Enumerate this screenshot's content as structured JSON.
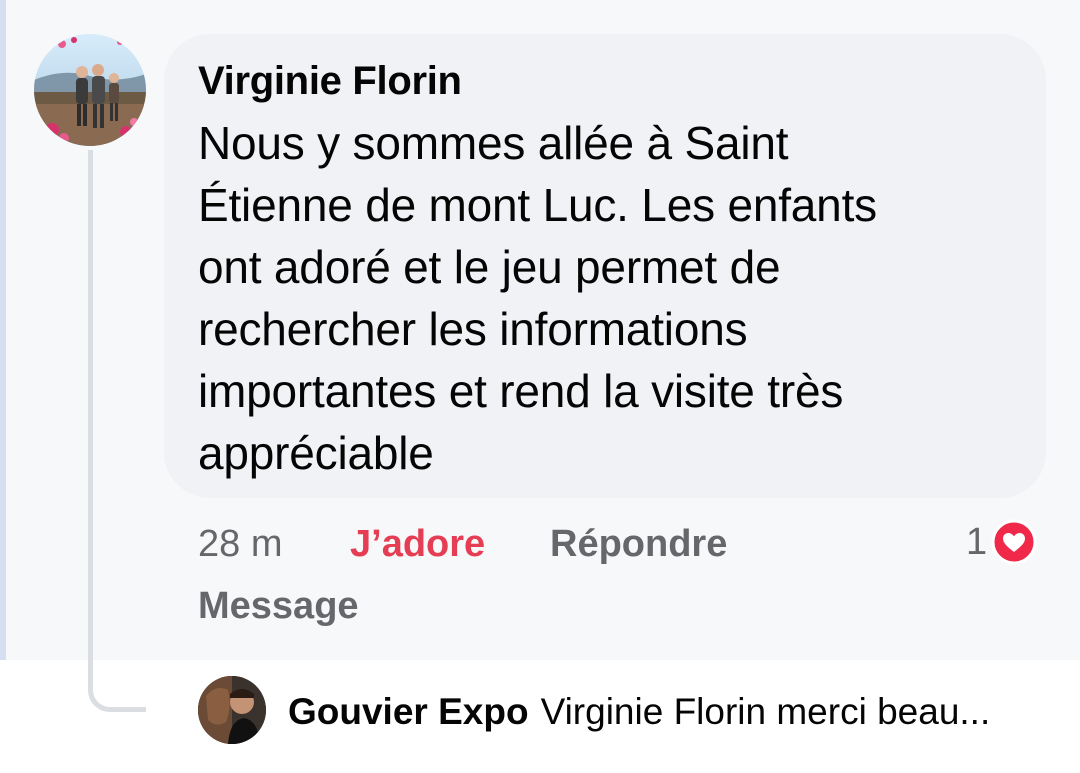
{
  "comment": {
    "author": "Virginie Florin",
    "text_lines": [
      "Nous y sommes allée à Saint",
      "Étienne de mont Luc. Les enfants",
      "ont adoré et le jeu permet de",
      "rechercher les informations",
      "importantes et rend la visite très",
      "appréciable"
    ],
    "timestamp": "28 m",
    "react_label": "J’adore",
    "reply_label": "Répondre",
    "message_label": "Message",
    "reaction_count": "1",
    "reaction_icon": "heart-icon",
    "colors": {
      "react_active": "#e53e54",
      "secondary_text": "#65676b",
      "bubble": "#f0f2f5",
      "heart": "#f0284a"
    }
  },
  "reply_preview": {
    "author": "Gouvier Expo",
    "snippet": "Virginie Florin merci beau..."
  }
}
